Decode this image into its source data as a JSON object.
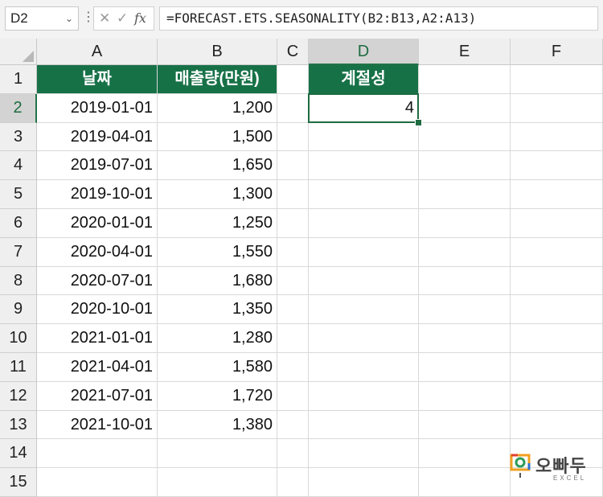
{
  "formula_bar": {
    "name_box": "D2",
    "formula": "=FORECAST.ETS.SEASONALITY(B2:B13,A2:A13)",
    "fx_label": "fx",
    "cancel_glyph": "✕",
    "enter_glyph": "✓"
  },
  "columns": [
    "A",
    "B",
    "C",
    "D",
    "E",
    "F"
  ],
  "rows": [
    "1",
    "2",
    "3",
    "4",
    "5",
    "6",
    "7",
    "8",
    "9",
    "10",
    "11",
    "12",
    "13",
    "14",
    "15"
  ],
  "headers": {
    "date": "날짜",
    "sales": "매출량(만원)",
    "seasonality": "계절성"
  },
  "table": [
    {
      "date": "2019-01-01",
      "sales": "1,200"
    },
    {
      "date": "2019-04-01",
      "sales": "1,500"
    },
    {
      "date": "2019-07-01",
      "sales": "1,650"
    },
    {
      "date": "2019-10-01",
      "sales": "1,300"
    },
    {
      "date": "2020-01-01",
      "sales": "1,250"
    },
    {
      "date": "2020-04-01",
      "sales": "1,550"
    },
    {
      "date": "2020-07-01",
      "sales": "1,680"
    },
    {
      "date": "2020-10-01",
      "sales": "1,350"
    },
    {
      "date": "2021-01-01",
      "sales": "1,280"
    },
    {
      "date": "2021-04-01",
      "sales": "1,580"
    },
    {
      "date": "2021-07-01",
      "sales": "1,720"
    },
    {
      "date": "2021-10-01",
      "sales": "1,380"
    }
  ],
  "result": "4",
  "colors": {
    "header_green": "#177147",
    "selection_green": "#1e6b41"
  },
  "logo": {
    "text": "오빠두",
    "sub": "EXCEL"
  }
}
